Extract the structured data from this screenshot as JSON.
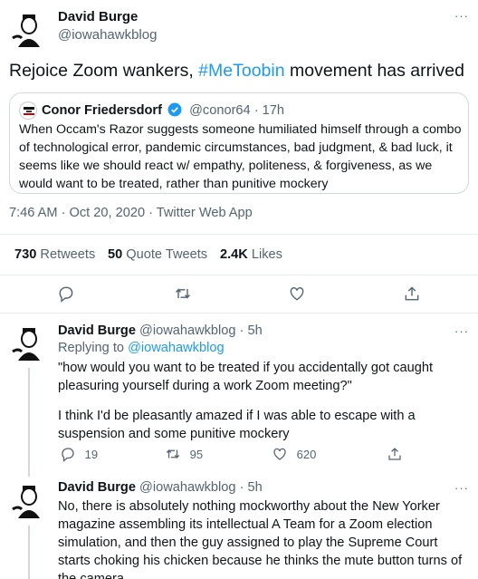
{
  "main_tweet": {
    "author_name": "David Burge",
    "author_handle": "@iowahawkblog",
    "more": "···",
    "text_before": "Rejoice Zoom wankers, ",
    "hashtag": "#MeToobin",
    "text_after": " movement has arrived",
    "quoted": {
      "author_name": "Conor Friedersdorf",
      "author_handle": "@conor64",
      "sep": "·",
      "time": "17h",
      "text": "When Occam's Razor suggests someone humiliated himself through a combo of technological error, pandemic circumstances, bad judgment, & bad luck, it seems like we should react w/ empathy, politeness, & forgiveness, as we would want to be treated, rather than punitive mockery"
    },
    "timestamp": "7:46 AM · Oct 20, 2020 · Twitter Web App",
    "stats": {
      "retweets_count": "730",
      "retweets_label": "Retweets",
      "quote_count": "50",
      "quote_label": "Quote Tweets",
      "likes_count": "2.4K",
      "likes_label": "Likes"
    }
  },
  "replies": [
    {
      "author_name": "David Burge",
      "author_handle": "@iowahawkblog",
      "time": "· 5h",
      "replying_prefix": "Replying to ",
      "replying_to": "@iowahawkblog",
      "text_p1": "\"how would you want to be treated if you accidentally got caught pleasuring yourself during a work Zoom meeting?\"",
      "text_p2": "I think I'd be pleasantly amazed if I was able to escape with a suspension and some punitive mockery",
      "reply_count": "19",
      "retweet_count": "95",
      "like_count": "620"
    },
    {
      "author_name": "David Burge",
      "author_handle": "@iowahawkblog",
      "time": "· 5h",
      "text": "No, there is absolutely nothing mockworthy about the New Yorker magazine assembling its intellectual A Team for a Zoom election simulation, and then the guy assigned to play the Supreme Court starts choking his chicken because he thinks the mute button turns of the camera"
    }
  ],
  "colors": {
    "accent": "#1d9bf0",
    "text": "#0f1419",
    "muted": "#536471",
    "border": "#cfd9de"
  },
  "icons": [
    "reply-icon",
    "retweet-icon",
    "like-icon",
    "share-icon",
    "verified-icon",
    "more-icon"
  ]
}
